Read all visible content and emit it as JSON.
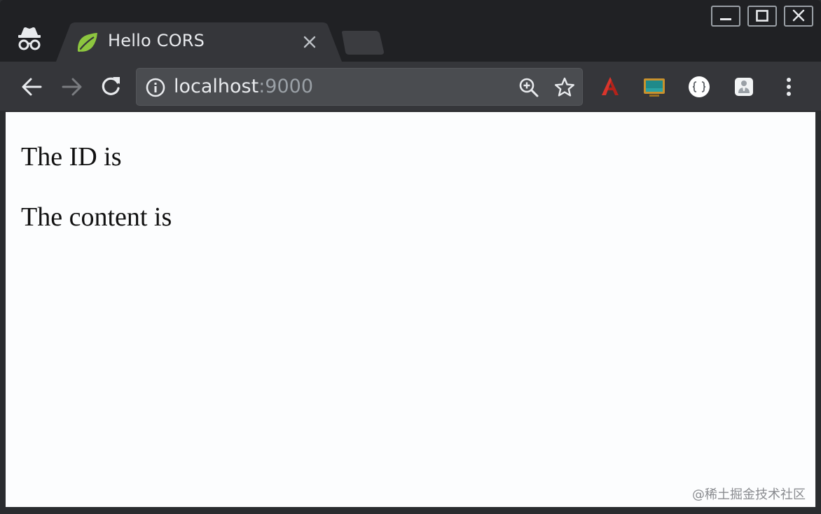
{
  "browser": {
    "tab": {
      "title": "Hello CORS",
      "favicon": "spring-leaf-icon"
    },
    "window_controls": [
      "minimize-icon",
      "maximize-icon",
      "close-icon"
    ],
    "toolbar": {
      "back": "arrow-left-icon",
      "forward": "arrow-right-icon",
      "reload": "reload-icon",
      "menu": "more-vert-icon"
    },
    "omnibox": {
      "host": "localhost",
      "port": ":9000",
      "info_icon": "info-icon",
      "zoom_icon": "zoom-in-icon",
      "star_icon": "star-icon"
    },
    "extensions": [
      "acrobat-icon",
      "screen-capture-icon",
      "json-viewer-icon",
      "user-icon"
    ]
  },
  "page": {
    "id_line": "The ID is",
    "content_line": "The content is",
    "watermark": "@稀土掘金技术社区"
  },
  "colors": {
    "frame": "#202124",
    "toolbar": "#35363a",
    "omnibox": "#4a4c50",
    "page_bg": "#fcfdfe",
    "spring_green": "#8dc63f"
  }
}
